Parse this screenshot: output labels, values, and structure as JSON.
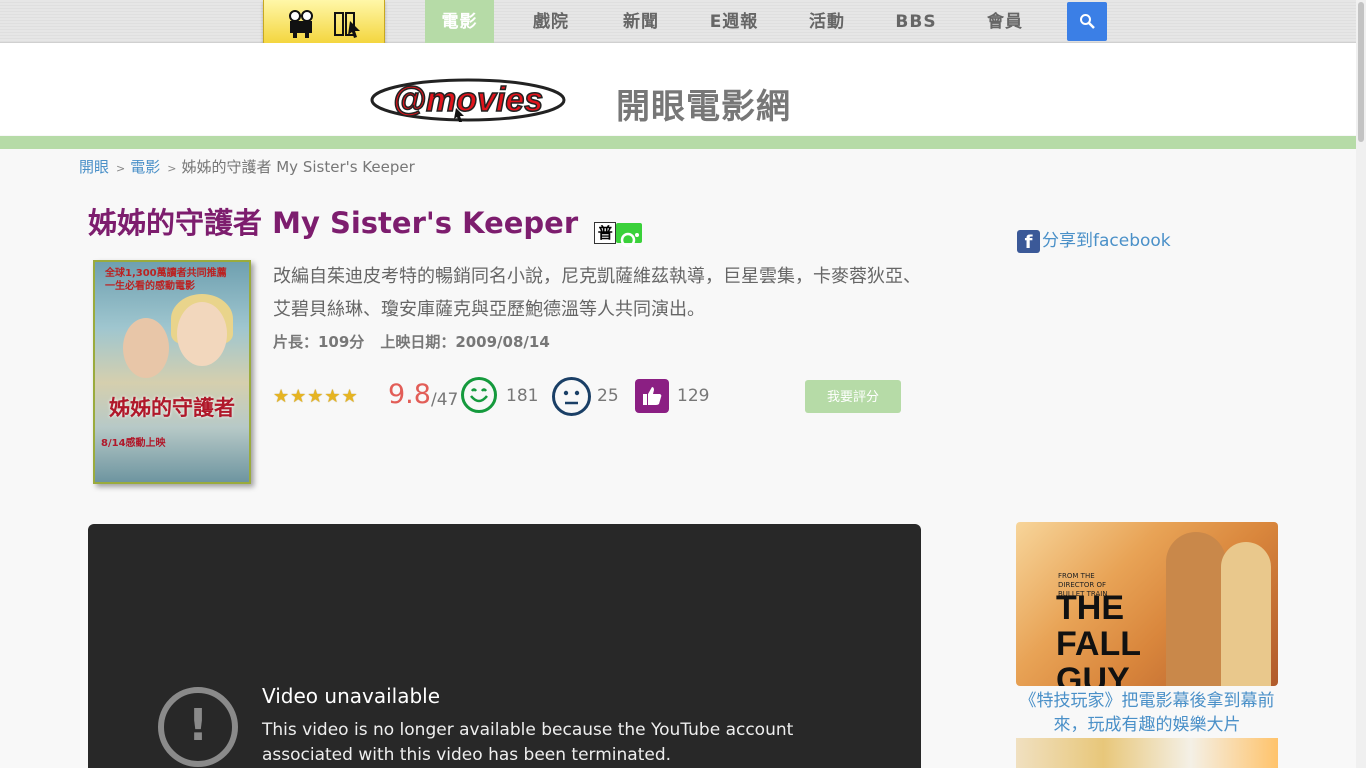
{
  "nav": {
    "items": [
      "電影",
      "戲院",
      "新聞",
      "E週報",
      "活動",
      "BBS",
      "會員"
    ],
    "active": "電影",
    "search_icon": "search-icon"
  },
  "header": {
    "logo_text": "@movies",
    "site_name": "開眼電影網"
  },
  "breadcrumb": {
    "home": "開眼",
    "section": "電影",
    "current": "姊姊的守護者 My Sister's Keeper",
    "separator": ">"
  },
  "movie": {
    "title": "姊姊的守護者 My Sister's Keeper",
    "rating_label": "普",
    "description": "改編自茱迪皮考特的暢銷同名小說，尼克凱薩維茲執導，巨星雲集，卡麥蓉狄亞、艾碧貝絲琳、瓊安庫薩克與亞歷鮑德溫等人共同演出。",
    "length": "片長：109分",
    "release": "上映日期：2009/08/14",
    "poster": {
      "top_text": "全球1,300萬讀者共同推薦\n一生必看的感動電影",
      "title_text": "姊姊的守護者",
      "date_text": "8/14感動上映"
    }
  },
  "rating": {
    "stars": "★★★★★",
    "stars_value": 5,
    "score": "9.8",
    "votes": "/47",
    "good": "181",
    "neutral": "25",
    "like": "129",
    "rate_button": "我要評分"
  },
  "share": {
    "label": "分享到facebook"
  },
  "video": {
    "title": "Video unavailable",
    "message": "This video is no longer available because the YouTube account associated with this video has been terminated."
  },
  "sidebar_ad": {
    "image_text": "THE FALL GUY",
    "small_text": "FROM THE DIRECTOR OF BULLET TRAIN",
    "caption": "《特技玩家》把電影幕後拿到幕前來，玩成有趣的娛樂大片"
  },
  "colors": {
    "accent_green": "#b6dba7",
    "title_purple": "#7d1d6e",
    "link_blue": "#4a90c8",
    "score_red": "#e25d57",
    "search_blue": "#3b7fe6"
  }
}
